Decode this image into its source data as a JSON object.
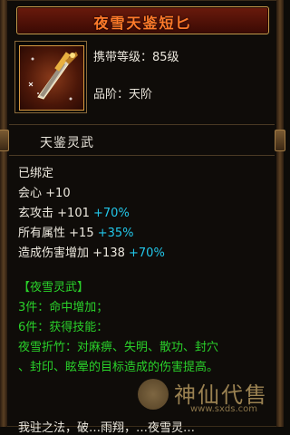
{
  "tooltip": {
    "title": "夜雪天鉴短匕",
    "carry_level": "携带等级：85级",
    "grade": "品阶：天阶",
    "section_title": "天鉴灵武",
    "bind_status": "已绑定",
    "stats": [
      {
        "name": "会心",
        "base": "+10",
        "bonus": ""
      },
      {
        "name": "玄攻击",
        "base": "+101",
        "bonus": "+70%"
      },
      {
        "name": "所有属性",
        "base": "+15",
        "bonus": "+35%"
      },
      {
        "name": "造成伤害增加",
        "base": "+138",
        "bonus": "+70%"
      }
    ],
    "set": {
      "name": "【夜雪灵武】",
      "line1": "3件：命中增加；",
      "line2": "6件：获得技能：",
      "skill_line1": "夜雪折竹：对麻痹、失明、散功、封穴",
      "skill_line2": "、封印、眩晕的目标造成的伤害提高。"
    },
    "bottom_cut_text": "我驻之法，破…雨翔，…夜雪灵…"
  },
  "watermark": {
    "text": "神仙代售",
    "url": "www.sxds.com"
  },
  "colors": {
    "title": "#ff7a2a",
    "green": "#2ad12a",
    "cyan": "#22c7ea",
    "white": "#ece8de"
  }
}
